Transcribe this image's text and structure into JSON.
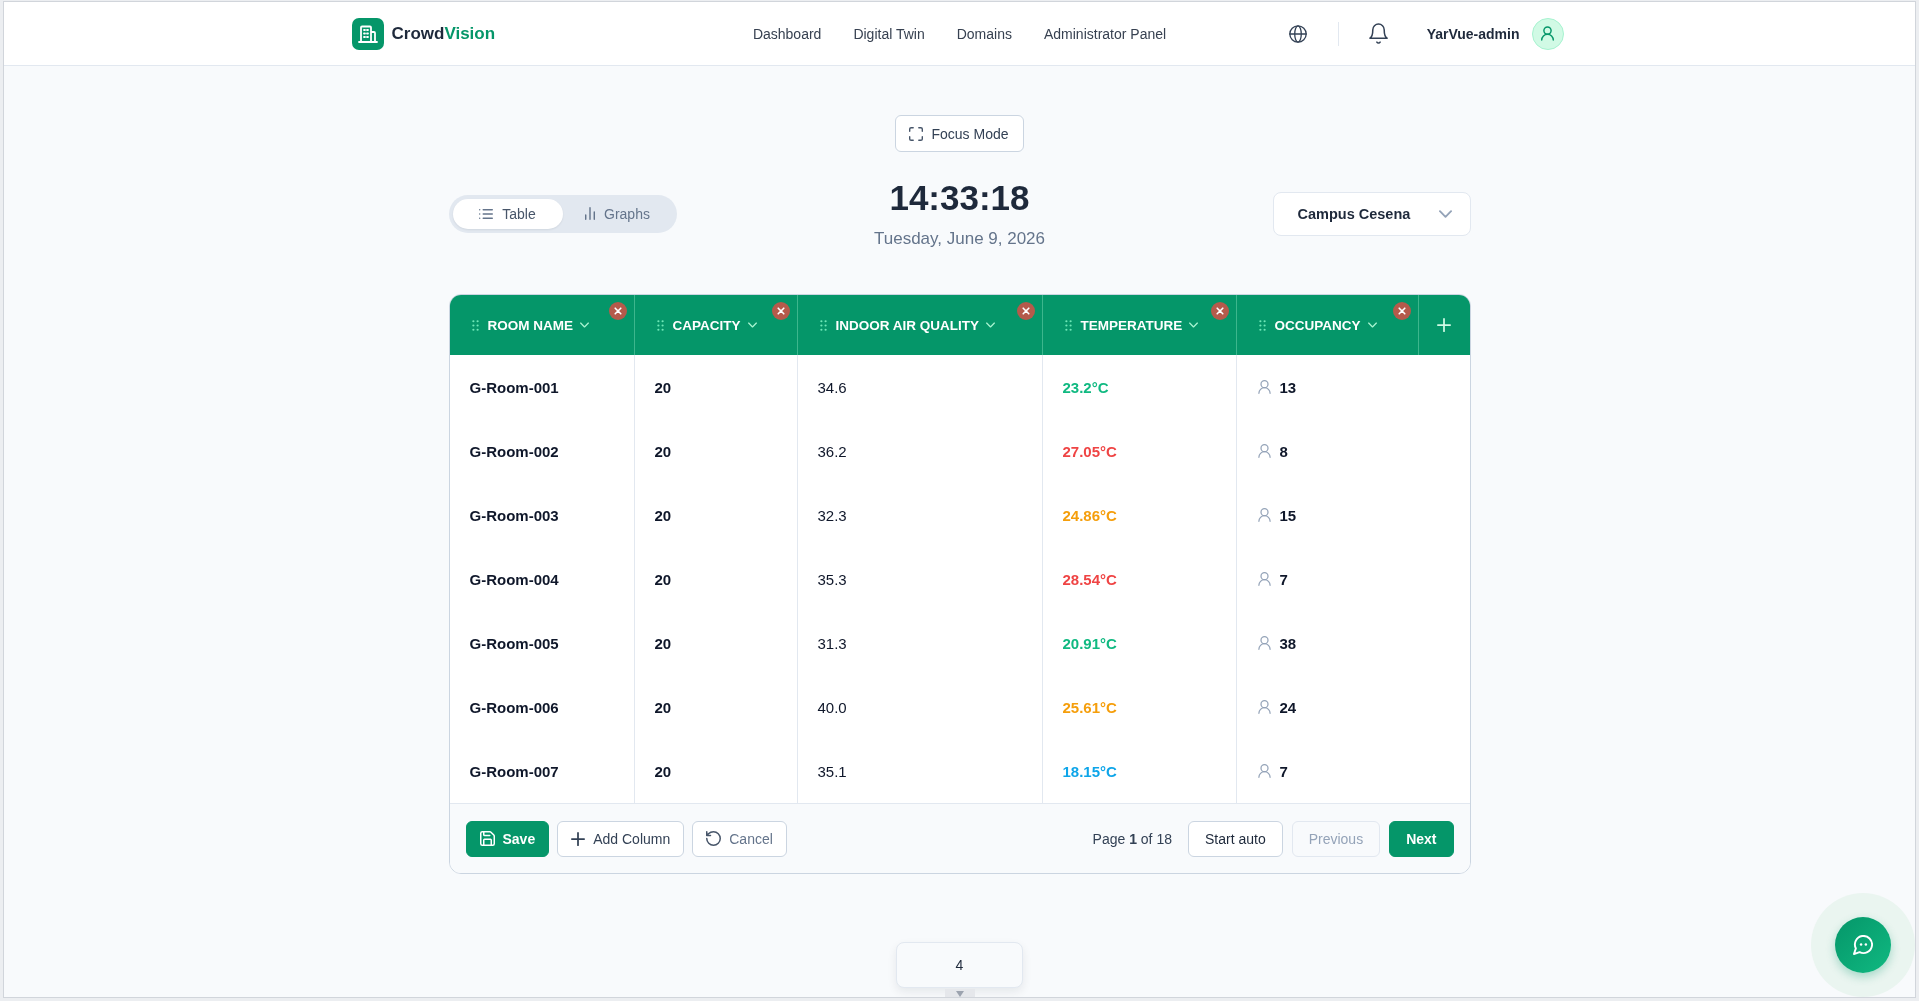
{
  "header": {
    "logo": {
      "text": "Crowd",
      "accent": "Vision"
    },
    "nav": [
      {
        "label": "Dashboard",
        "selected": false
      },
      {
        "label": "Digital Twin",
        "selected": false
      },
      {
        "label": "Domains",
        "selected": false
      },
      {
        "label": "Administrator Panel",
        "selected": false
      }
    ],
    "user": {
      "name": "YarVue-admin"
    }
  },
  "focus_button": {
    "label": "Focus Mode"
  },
  "view_tabs": [
    {
      "label": "Table",
      "selected": true
    },
    {
      "label": "Graphs",
      "selected": false
    }
  ],
  "clock": {
    "time": "14:33:18",
    "date": "Tuesday, June 9, 2026"
  },
  "campus_select": {
    "value": "Campus Cesena"
  },
  "table": {
    "columns": [
      {
        "label": "ROOM NAME"
      },
      {
        "label": "CAPACITY"
      },
      {
        "label": "INDOOR AIR QUALITY"
      },
      {
        "label": "TEMPERATURE"
      },
      {
        "label": "OCCUPANCY"
      }
    ],
    "rows": [
      {
        "room_name": "G-Room-001",
        "capacity": "20",
        "indoor_air_quality": "34.6",
        "temperature": {
          "value": "23.2°C",
          "color": "#10b981"
        },
        "occupancy": "13"
      },
      {
        "room_name": "G-Room-002",
        "capacity": "20",
        "indoor_air_quality": "36.2",
        "temperature": {
          "value": "27.05°C",
          "color": "#ef4444"
        },
        "occupancy": "8"
      },
      {
        "room_name": "G-Room-003",
        "capacity": "20",
        "indoor_air_quality": "32.3",
        "temperature": {
          "value": "24.86°C",
          "color": "#f59e0b"
        },
        "occupancy": "15"
      },
      {
        "room_name": "G-Room-004",
        "capacity": "20",
        "indoor_air_quality": "35.3",
        "temperature": {
          "value": "28.54°C",
          "color": "#ef4444"
        },
        "occupancy": "7"
      },
      {
        "room_name": "G-Room-005",
        "capacity": "20",
        "indoor_air_quality": "31.3",
        "temperature": {
          "value": "20.91°C",
          "color": "#10b981"
        },
        "occupancy": "38"
      },
      {
        "room_name": "G-Room-006",
        "capacity": "20",
        "indoor_air_quality": "40.0",
        "temperature": {
          "value": "25.61°C",
          "color": "#f59e0b"
        },
        "occupancy": "24"
      },
      {
        "room_name": "G-Room-007",
        "capacity": "20",
        "indoor_air_quality": "35.1",
        "temperature": {
          "value": "18.15°C",
          "color": "#0ea5e9"
        },
        "occupancy": "7"
      }
    ]
  },
  "table_footer": {
    "actions": [
      {
        "kind": "save",
        "label": "Save"
      },
      {
        "kind": "add",
        "label": "Add Column"
      },
      {
        "kind": "undo",
        "label": "Cancel"
      }
    ],
    "page_info": "Page **1** of 18",
    "pager": [
      {
        "kind": "outline",
        "label": "Start auto",
        "disabled": false
      },
      {
        "kind": "outline",
        "label": "Previous",
        "disabled": true
      },
      {
        "kind": "primary",
        "label": "Next",
        "disabled": false
      }
    ]
  },
  "tooltip": {
    "text": "4"
  }
}
